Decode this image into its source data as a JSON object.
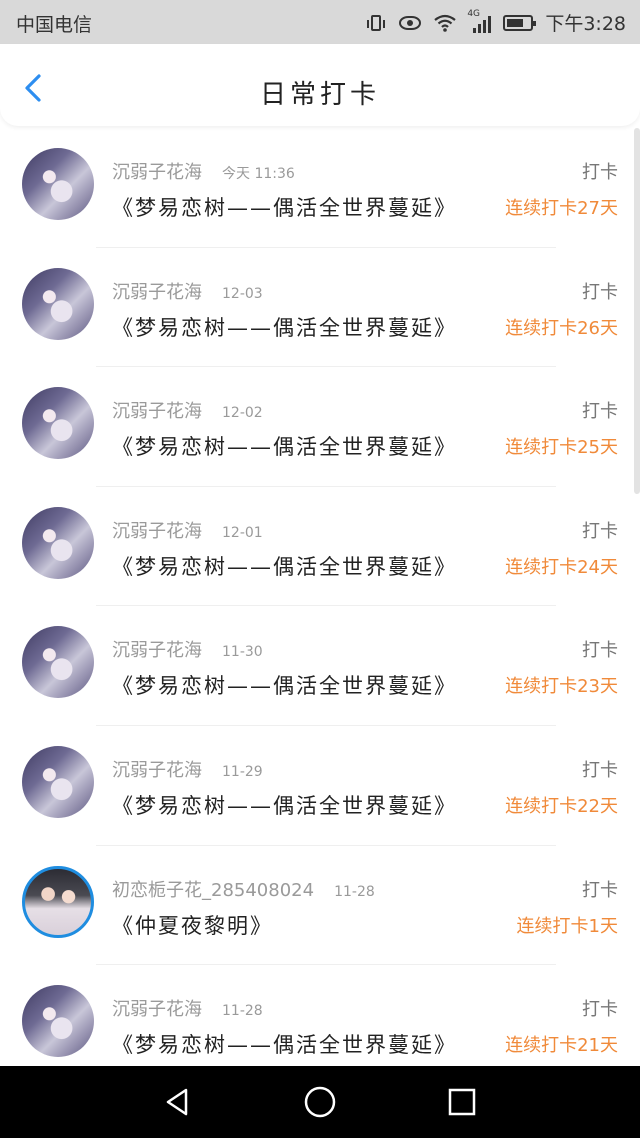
{
  "status_bar": {
    "carrier": "中国电信",
    "network": "4G",
    "time": "下午3:28"
  },
  "header": {
    "title": "日常打卡",
    "back_icon": "chevron-left-icon",
    "accent_color": "#2d8ef0"
  },
  "colors": {
    "streak": "#f08a3a",
    "username": "#9a9a9a"
  },
  "rows": [
    {
      "user": "沉弱子花海",
      "date": "今天 11:36",
      "book": "《梦易恋树——偶活全世界蔓延》",
      "tag": "打卡",
      "streak": "连续打卡27天",
      "avatar": "anime"
    },
    {
      "user": "沉弱子花海",
      "date": "12-03",
      "book": "《梦易恋树——偶活全世界蔓延》",
      "tag": "打卡",
      "streak": "连续打卡26天",
      "avatar": "anime"
    },
    {
      "user": "沉弱子花海",
      "date": "12-02",
      "book": "《梦易恋树——偶活全世界蔓延》",
      "tag": "打卡",
      "streak": "连续打卡25天",
      "avatar": "anime"
    },
    {
      "user": "沉弱子花海",
      "date": "12-01",
      "book": "《梦易恋树——偶活全世界蔓延》",
      "tag": "打卡",
      "streak": "连续打卡24天",
      "avatar": "anime"
    },
    {
      "user": "沉弱子花海",
      "date": "11-30",
      "book": "《梦易恋树——偶活全世界蔓延》",
      "tag": "打卡",
      "streak": "连续打卡23天",
      "avatar": "anime"
    },
    {
      "user": "沉弱子花海",
      "date": "11-29",
      "book": "《梦易恋树——偶活全世界蔓延》",
      "tag": "打卡",
      "streak": "连续打卡22天",
      "avatar": "anime"
    },
    {
      "user": "初恋栀子花_285408024",
      "date": "11-28",
      "book": "《仲夏夜黎明》",
      "tag": "打卡",
      "streak": "连续打卡1天",
      "avatar": "couple"
    },
    {
      "user": "沉弱子花海",
      "date": "11-28",
      "book": "《梦易恋树——偶活全世界蔓延》",
      "tag": "打卡",
      "streak": "连续打卡21天",
      "avatar": "anime"
    }
  ],
  "nav_bar": {
    "back": "triangle-back-icon",
    "home": "circle-home-icon",
    "recent": "square-recent-icon"
  }
}
